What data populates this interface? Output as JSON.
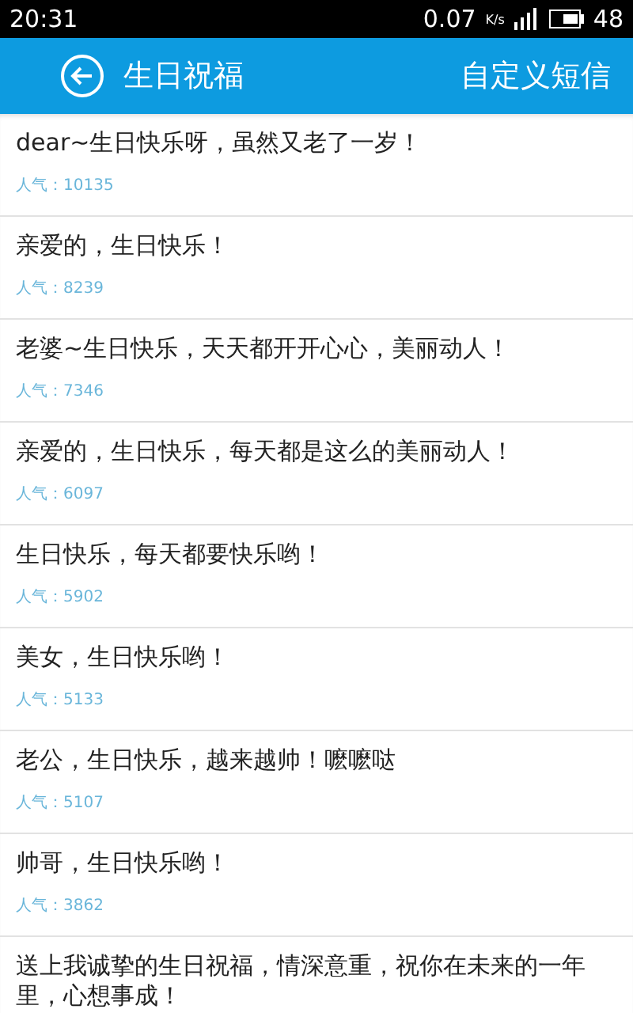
{
  "status_bar": {
    "time": "20:31",
    "speed": "0.07",
    "speed_unit": "K/s",
    "battery": "48"
  },
  "header": {
    "title": "生日祝福",
    "action": "自定义短信"
  },
  "messages": [
    {
      "text": "dear~生日快乐呀，虽然又老了一岁！",
      "popularity": "人气：10135"
    },
    {
      "text": "亲爱的，生日快乐！",
      "popularity": "人气：8239"
    },
    {
      "text": "老婆~生日快乐，天天都开开心心，美丽动人！",
      "popularity": "人气：7346"
    },
    {
      "text": "亲爱的，生日快乐，每天都是这么的美丽动人！",
      "popularity": "人气：6097"
    },
    {
      "text": "生日快乐，每天都要快乐哟！",
      "popularity": "人气：5902"
    },
    {
      "text": "美女，生日快乐哟！",
      "popularity": "人气：5133"
    },
    {
      "text": "老公，生日快乐，越来越帅！嚒嚒哒",
      "popularity": "人气：5107"
    },
    {
      "text": "帅哥，生日快乐哟！",
      "popularity": "人气：3862"
    },
    {
      "text": "送上我诚挚的生日祝福，情深意重，祝你在未来的一年里，心想事成！"
    }
  ]
}
